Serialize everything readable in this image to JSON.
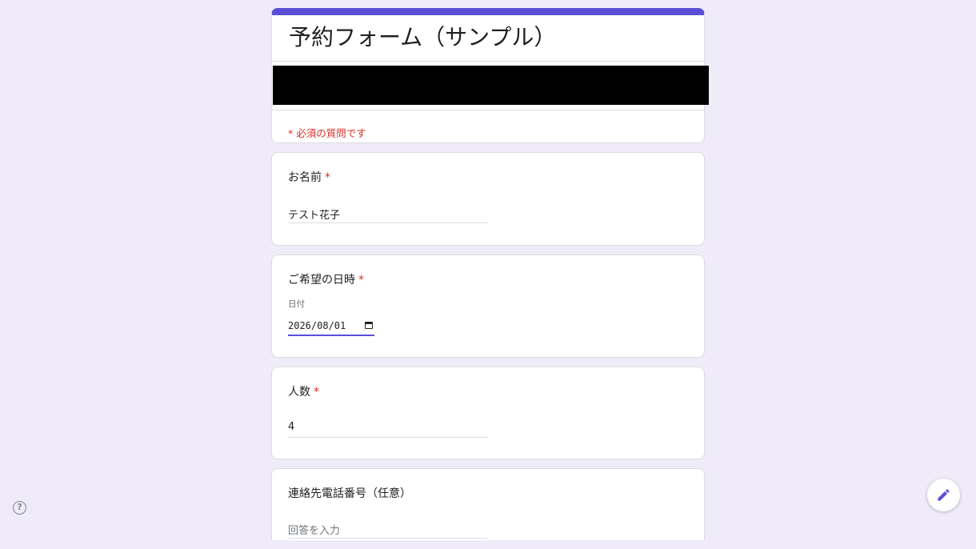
{
  "form": {
    "title": "予約フォーム（サンプル）",
    "required_note": "* 必須の質問です"
  },
  "questions": {
    "name": {
      "label": "お名前",
      "required_mark": "*",
      "answer": "テスト花子"
    },
    "date": {
      "label": "ご希望の日時",
      "required_mark": "*",
      "sub_label": "日付",
      "value": "2026/08/01"
    },
    "people": {
      "label": "人数",
      "required_mark": "*",
      "answer": "4"
    },
    "phone": {
      "label": "連絡先電話番号（任意）",
      "placeholder": "回答を入力"
    }
  },
  "help": {
    "glyph": "?"
  },
  "colors": {
    "accent": "#5b4fd6",
    "required": "#d93025",
    "background": "#f0ebf8"
  },
  "icons": {
    "help": "help-circle-icon",
    "edit": "pencil-icon",
    "calendar": "calendar-icon"
  }
}
